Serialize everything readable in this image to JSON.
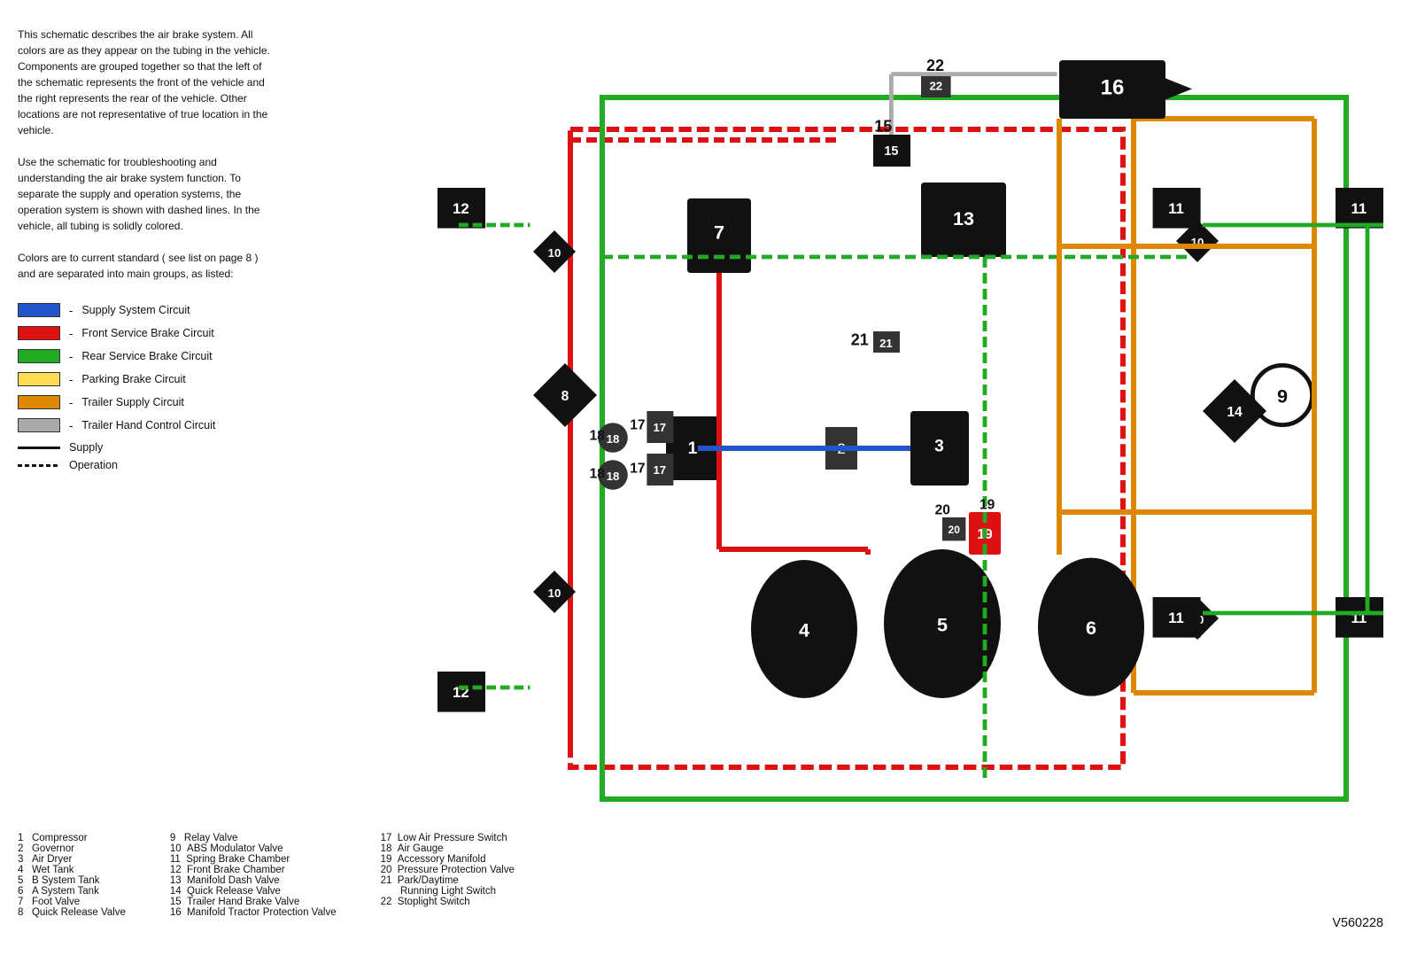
{
  "description": {
    "para1": "This schematic describes the air brake system. All colors are as they appear on the tubing in the vehicle. Components are grouped together so that the left of the schematic represents the front of the vehicle and the right represents the rear of the vehicle. Other locations are not representative of true location in the vehicle.",
    "para2": "Use the schematic for troubleshooting and understanding the air brake system function. To separate the supply and operation systems, the operation system is shown with dashed lines. In the vehicle, all tubing is solidly colored.",
    "para3": "Colors are to current standard ( see list on page 8 ) and are separated into main groups, as listed:"
  },
  "legend": {
    "items": [
      {
        "color": "#2255cc",
        "label": "Supply System Circuit"
      },
      {
        "color": "#dd1111",
        "label": "Front Service Brake Circuit"
      },
      {
        "color": "#22aa22",
        "label": "Rear Service Brake Circuit"
      },
      {
        "color": "#ffdd55",
        "label": "Parking Brake Circuit"
      },
      {
        "color": "#dd8800",
        "label": "Trailer Supply Circuit"
      },
      {
        "color": "#aaaaaa",
        "label": "Trailer Hand Control Circuit"
      }
    ],
    "line_types": [
      {
        "type": "solid",
        "label": "Supply"
      },
      {
        "type": "dashed",
        "label": "Operation"
      }
    ]
  },
  "components": {
    "col1": [
      "1   Compressor",
      "2   Governor",
      "3   Air Dryer",
      "4   Wet Tank",
      "5   B System Tank",
      "6   A System Tank",
      "7   Foot Valve",
      "8   Quick Release Valve"
    ],
    "col2": [
      "9   Relay Valve",
      "10  ABS Modulator Valve",
      "11  Spring Brake Chamber",
      "12  Front Brake Chamber",
      "13  Manifold Dash Valve",
      "14  Quick Release Valve",
      "15  Trailer Hand Brake Valve",
      "16  Manifold Tractor Protection Valve"
    ],
    "col3": [
      "17  Low Air Pressure Switch",
      "18  Air Gauge",
      "19  Accessory Manifold",
      "20  Pressure Protection Valve",
      "21  Park/Daytime",
      "       Running Light Switch",
      "22  Stoplight Switch"
    ]
  },
  "diagram_id": "V560228"
}
